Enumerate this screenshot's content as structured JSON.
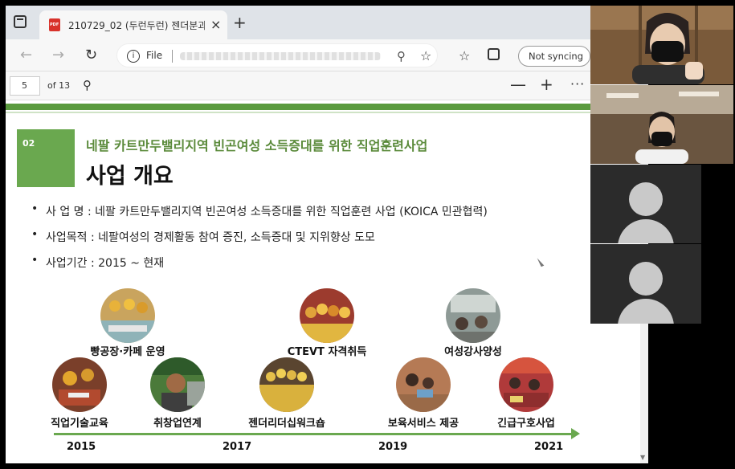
{
  "browser": {
    "tab_title": "210729_02 (두런두런) 젠더분과",
    "tab_close": "×",
    "new_tab": "+",
    "address_file_label": "File",
    "info_glyph": "i",
    "sync_label": "Not syncing"
  },
  "pdf_toolbar": {
    "page_current": "5",
    "page_total": "of 13",
    "zoom_out": "—",
    "zoom_in": "+",
    "more": "···"
  },
  "slide": {
    "section_number": "02",
    "subtitle": "네팔 카트만두밸리지역 빈곤여성 소득증대를 위한 직업훈련사업",
    "title": "사업 개요",
    "bullets": [
      "사 업 명 : 네팔 카트만두밸리지역 빈곤여성 소득증대를 위한 직업훈련 사업 (KOICA 민관협력)",
      "사업목적 : 네팔여성의 경제활동 참여 증진, 소득증대 및 지위향상 도모",
      "사업기간 : 2015 ~ 현재"
    ],
    "activities": [
      {
        "label": "빵공장·카페 운영"
      },
      {
        "label": "직업기술교육"
      },
      {
        "label": "취창업연계"
      },
      {
        "label": "CTEVT 자격취득"
      },
      {
        "label": "젠더리더십워크숍"
      },
      {
        "label": "여성강사양성"
      },
      {
        "label": "보육서비스 제공"
      },
      {
        "label": "긴급구호사업"
      }
    ],
    "timeline_years": [
      "2015",
      "2017",
      "2019",
      "2021"
    ]
  },
  "colors": {
    "accent_green": "#6aa84f",
    "subtitle_green": "#5a8a3a",
    "tab_strip": "#dfe3e8"
  }
}
